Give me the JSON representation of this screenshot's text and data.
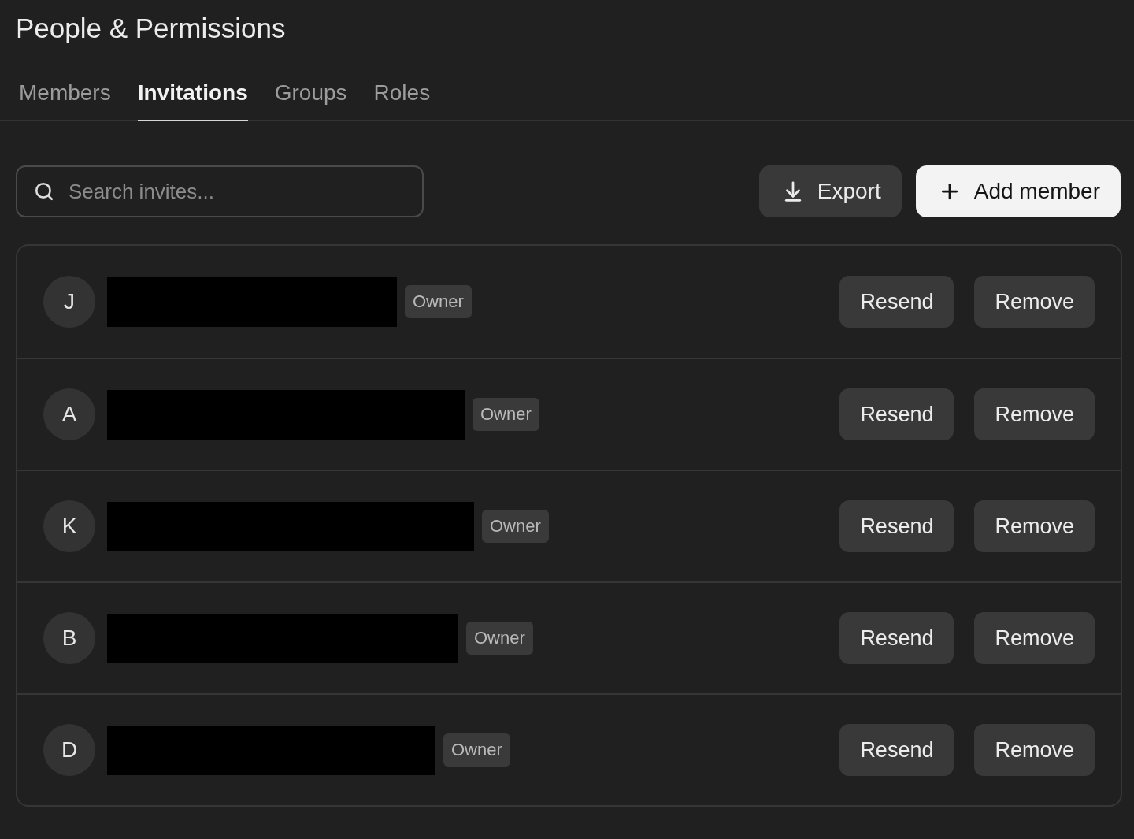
{
  "header": {
    "title": "People & Permissions"
  },
  "tabs": [
    {
      "label": "Members",
      "selected": false
    },
    {
      "label": "Invitations",
      "selected": true
    },
    {
      "label": "Groups",
      "selected": false
    },
    {
      "label": "Roles",
      "selected": false
    }
  ],
  "toolbar": {
    "search": {
      "placeholder": "Search invites..."
    },
    "buttons": [
      {
        "kind": "secondary",
        "label": "Export"
      },
      {
        "kind": "primary",
        "label": "Add member"
      }
    ]
  },
  "invitations": [
    {
      "initial": "J",
      "role": "Owner",
      "actions": [
        "Resend",
        "Remove"
      ]
    },
    {
      "initial": "A",
      "role": "Owner",
      "actions": [
        "Resend",
        "Remove"
      ]
    },
    {
      "initial": "K",
      "role": "Owner",
      "actions": [
        "Resend",
        "Remove"
      ]
    },
    {
      "initial": "B",
      "role": "Owner",
      "actions": [
        "Resend",
        "Remove"
      ]
    },
    {
      "initial": "D",
      "role": "Owner",
      "actions": [
        "Resend",
        "Remove"
      ]
    }
  ]
}
